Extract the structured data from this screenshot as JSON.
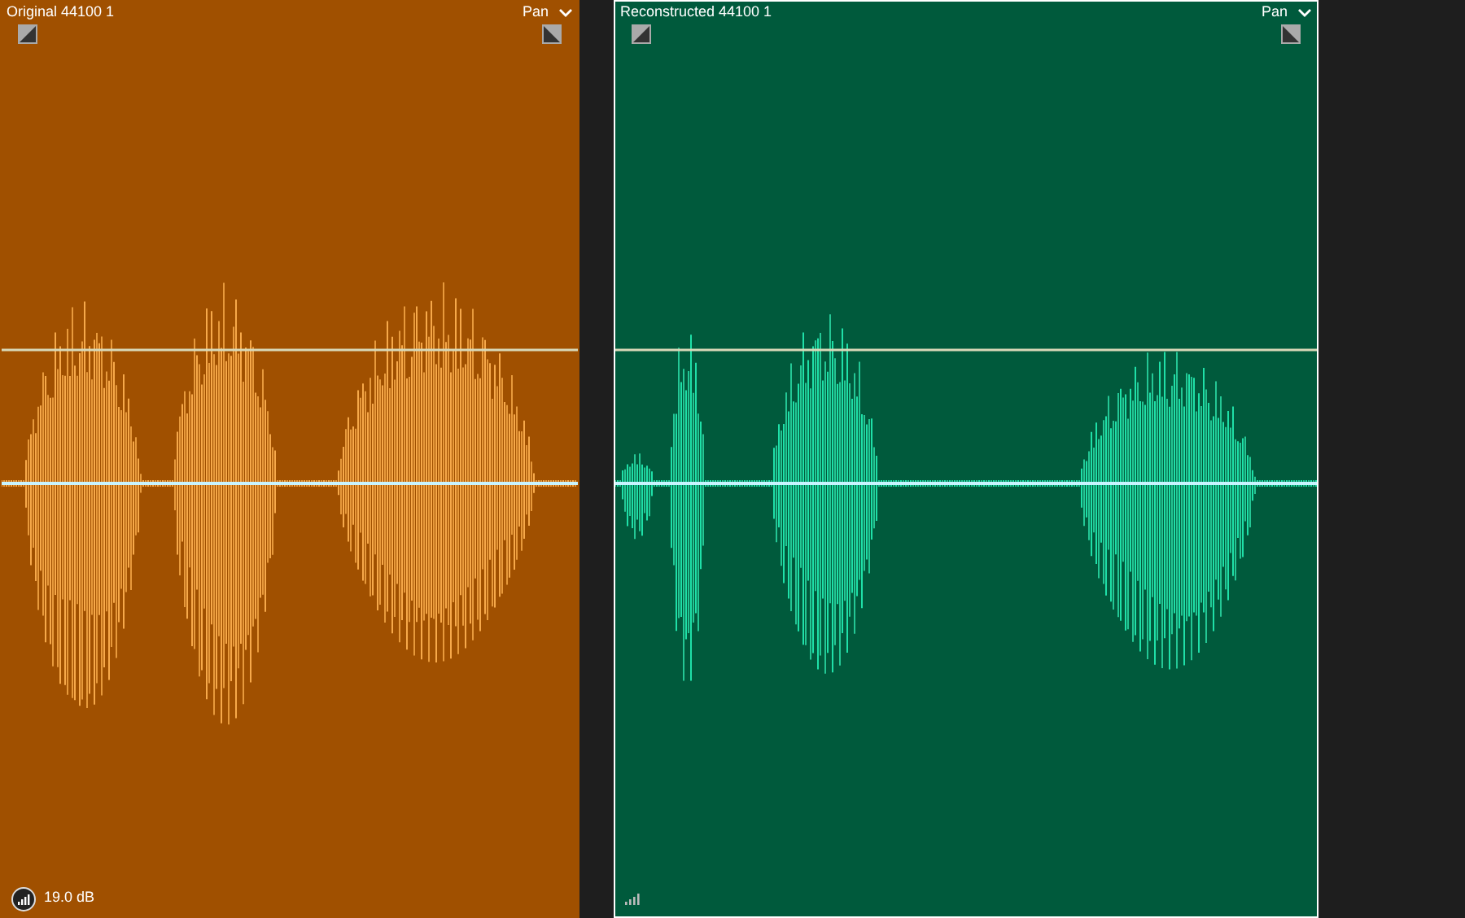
{
  "clips": [
    {
      "kind": "original",
      "title": "Original 44100 1",
      "pan_label": "Pan",
      "selected": false,
      "gain": "19.0 dB"
    },
    {
      "kind": "reconstructed",
      "title": "Reconstructed 44100 1",
      "pan_label": "Pan",
      "selected": true
    }
  ]
}
